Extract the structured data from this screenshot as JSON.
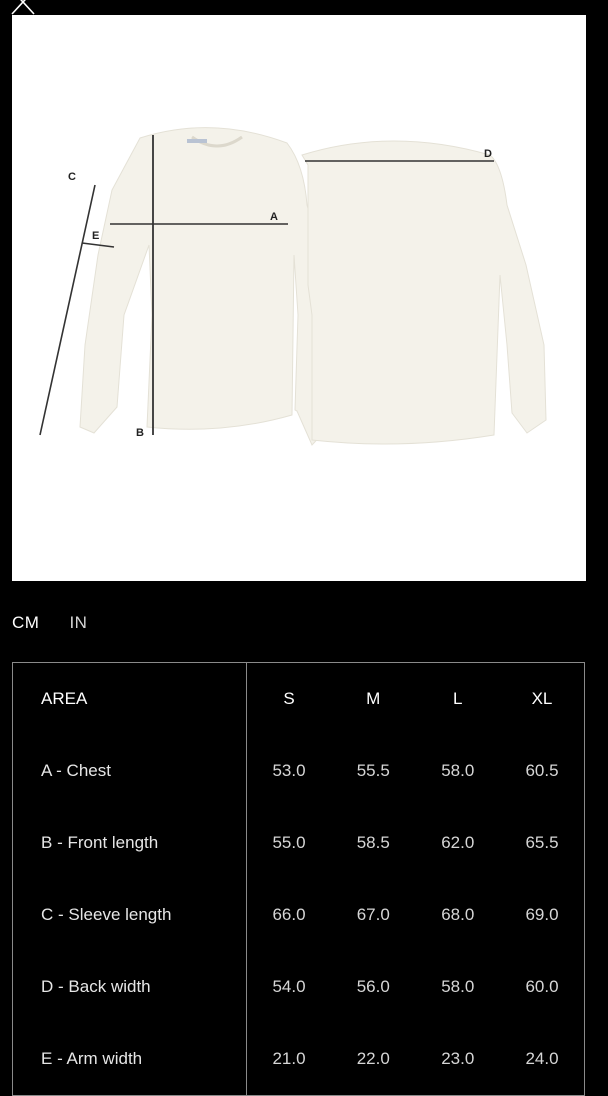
{
  "header": {
    "close_icon": "close-icon"
  },
  "diagram": {
    "image_alt": "sweater-front-and-back",
    "labels": {
      "A": "A",
      "B": "B",
      "C": "C",
      "D": "D",
      "E": "E"
    }
  },
  "unit_tabs": [
    {
      "label": "CM",
      "active": true
    },
    {
      "label": "IN",
      "active": false
    }
  ],
  "size_table": {
    "header": {
      "area": "AREA",
      "sizes": [
        "S",
        "M",
        "L",
        "XL"
      ]
    },
    "rows": [
      {
        "letter": "A",
        "sep": "-",
        "name": "Chest",
        "values": [
          "53.0",
          "55.5",
          "58.0",
          "60.5"
        ]
      },
      {
        "letter": "B",
        "sep": "-",
        "name": "Front length",
        "values": [
          "55.0",
          "58.5",
          "62.0",
          "65.5"
        ]
      },
      {
        "letter": "C",
        "sep": "-",
        "name": "Sleeve length",
        "values": [
          "66.0",
          "67.0",
          "68.0",
          "69.0"
        ]
      },
      {
        "letter": "D",
        "sep": "-",
        "name": "Back width",
        "values": [
          "54.0",
          "56.0",
          "58.0",
          "60.0"
        ]
      },
      {
        "letter": "E",
        "sep": "-",
        "name": "Arm width",
        "values": [
          "21.0",
          "22.0",
          "23.0",
          "24.0"
        ]
      }
    ]
  },
  "colors": {
    "background": "#000000",
    "panel": "#ffffff",
    "garment": "#f4f2ea",
    "border": "#8a8a8a"
  }
}
